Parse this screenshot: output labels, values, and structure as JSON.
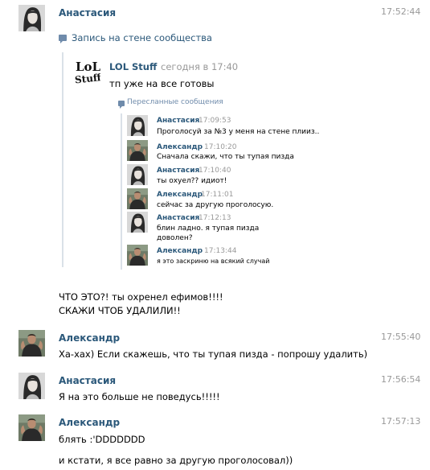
{
  "messages": [
    {
      "author": "Анастасия",
      "time": "17:52:44",
      "repost_link": "Запись на стене сообщества",
      "repost": {
        "source": "LOL Stuff",
        "source_time": "сегодня в 17:40",
        "logo_text": "LOL Stuff",
        "text": "тп уже на все готовы",
        "forwarded_label": "Пересланные сообщения",
        "forwarded": [
          {
            "author": "Анастасия",
            "time": "17:09:53",
            "lines": [
              "Проголосуй за №3 у меня на стене плииз.."
            ]
          },
          {
            "author": "Александр",
            "time": "17:10:20",
            "lines": [
              "Сначала скажи, что ты тупая пизда"
            ]
          },
          {
            "author": "Анастасия",
            "time": "17:10:40",
            "lines": [
              "ты охуел?? идиот!"
            ]
          },
          {
            "author": "Александр",
            "time": "17:11:01",
            "lines": [
              "сейчас за другую проголосую."
            ]
          },
          {
            "author": "Анастасия",
            "time": "17:12:13",
            "lines": [
              "блин ладно. я тупая пизда",
              "доволен?"
            ]
          },
          {
            "author": "Александр",
            "time": "17:13:44",
            "lines": [
              "я это заскриню на всякий случай"
            ]
          }
        ]
      },
      "lines": [
        "ЧТО ЭТО?! ты охренел ефимов!!!!",
        "СКАЖИ ЧТОБ УДАЛИЛИ!!"
      ]
    },
    {
      "author": "Александр",
      "time": "17:55:40",
      "lines": [
        "Ха-хах) Если скажешь, что ты тупая пизда - попрошу удалить)"
      ]
    },
    {
      "author": "Анастасия",
      "time": "17:56:54",
      "lines": [
        "Я на это больше не поведусь!!!!!"
      ]
    },
    {
      "author": "Александр",
      "time": "17:57:13",
      "lines": [
        "блять :'DDDDDDD",
        "и кстати, я все равно за другую проголосовал))"
      ]
    }
  ],
  "colors": {
    "name": "#2b587a",
    "time": "#999999",
    "divider": "#dae1e8",
    "icon": "#6f8bab"
  }
}
